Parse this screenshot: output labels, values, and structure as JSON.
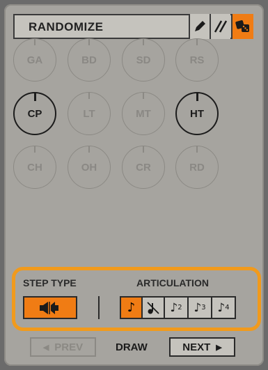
{
  "header": {
    "title": "RANDOMIZE",
    "buttons": [
      "pencil-icon",
      "slash-icon",
      "dice-icon"
    ],
    "active_button": "dice-icon"
  },
  "knobs": [
    {
      "label": "GA",
      "active": false
    },
    {
      "label": "BD",
      "active": false
    },
    {
      "label": "SD",
      "active": false
    },
    {
      "label": "RS",
      "active": false
    },
    {
      "label": "CP",
      "active": true
    },
    {
      "label": "LT",
      "active": false
    },
    {
      "label": "MT",
      "active": false
    },
    {
      "label": "HT",
      "active": true
    },
    {
      "label": "CH",
      "active": false
    },
    {
      "label": "OH",
      "active": false
    },
    {
      "label": "CR",
      "active": false
    },
    {
      "label": "RD",
      "active": false
    }
  ],
  "step_type": {
    "label": "STEP TYPE"
  },
  "articulation": {
    "label": "ARTICULATION",
    "subs": [
      "2",
      "3",
      "4"
    ]
  },
  "nav": {
    "prev": "PREV",
    "draw": "DRAW",
    "next": "NEXT"
  },
  "colors": {
    "accent": "#f07c14",
    "highlight": "#f19a1c",
    "panel": "#a6a49f"
  }
}
